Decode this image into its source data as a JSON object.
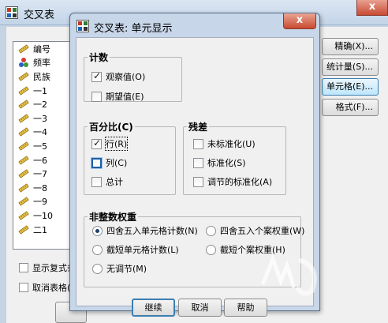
{
  "background_window": {
    "title": "交叉表",
    "close_glyph": "x",
    "variables": [
      "编号",
      "频率",
      "民族",
      "一1",
      "一2",
      "一3",
      "一4",
      "一5",
      "一6",
      "一7",
      "一8",
      "一9",
      "一10",
      "二1"
    ],
    "right_buttons": [
      "精确(X)...",
      "统计量(S)...",
      "单元格(E)...",
      "格式(F)..."
    ],
    "checkboxes": [
      "显示复式条",
      "取消表格(T"
    ]
  },
  "dialog": {
    "title": "交叉表: 单元显示",
    "close_glyph": "x",
    "counts": {
      "legend": "计数",
      "observed": "观察值(O)",
      "expected": "期望值(E)"
    },
    "percentages": {
      "legend": "百分比(C)",
      "row": "行(R)",
      "column": "列(C)",
      "total": "总计"
    },
    "residuals": {
      "legend": "残差",
      "unstandardized": "未标准化(U)",
      "standardized": "标准化(S)",
      "adjusted": "调节的标准化(A)"
    },
    "noninteger": {
      "legend": "非整数权重",
      "round_cell": "四舍五入单元格计数(N)",
      "round_case": "四舍五入个案权重(W)",
      "truncate_cell": "截短单元格计数(L)",
      "truncate_case": "截短个案权重(H)",
      "no_adjust": "无调节(M)"
    },
    "buttons": {
      "continue": "继续",
      "cancel": "取消",
      "help": "帮助"
    }
  }
}
